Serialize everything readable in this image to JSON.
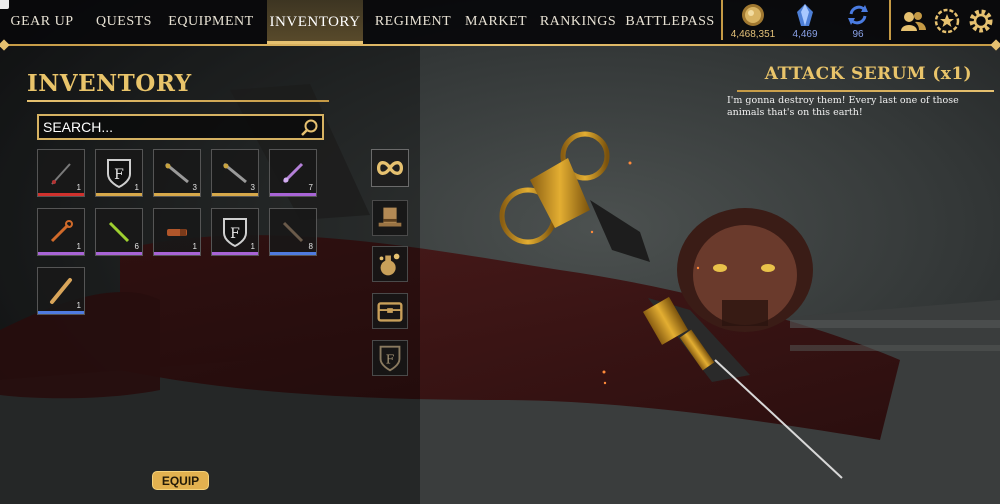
{
  "nav": {
    "tabs": [
      {
        "label": "GEAR UP"
      },
      {
        "label": "QUESTS"
      },
      {
        "label": "EQUIPMENT"
      },
      {
        "label": "INVENTORY",
        "active": true
      },
      {
        "label": "REGIMENT"
      },
      {
        "label": "MARKET"
      },
      {
        "label": "RANKINGS"
      },
      {
        "label": "BATTLEPASS"
      }
    ],
    "currencies": [
      {
        "icon": "gold-coin-icon",
        "value": "4,468,351",
        "color": "#e4c27a"
      },
      {
        "icon": "blue-crystal-icon",
        "value": "4,469",
        "color": "#8aa2e8"
      },
      {
        "icon": "refresh-token-icon",
        "value": "96",
        "color": "#8aa2e8"
      }
    ],
    "buttons": [
      "friends-icon",
      "achievements-icon",
      "settings-icon"
    ]
  },
  "inventory": {
    "title": "INVENTORY",
    "search_placeholder": "SEARCH...",
    "items": [
      {
        "icon": "red-blade-icon",
        "qty": "1",
        "rarity": "#d0312d"
      },
      {
        "icon": "family-crest-icon",
        "qty": "1",
        "rarity": "#d6a84a"
      },
      {
        "icon": "syringe-icon",
        "qty": "3",
        "rarity": "#d6a84a"
      },
      {
        "icon": "syringe-icon",
        "qty": "3",
        "rarity": "#d6a84a"
      },
      {
        "icon": "purple-syringe-icon",
        "qty": "7",
        "rarity": "#a864d6"
      },
      {
        "icon": "orange-key-icon",
        "qty": "1",
        "rarity": "#a864d6"
      },
      {
        "icon": "green-blade-icon",
        "qty": "6",
        "rarity": "#a864d6"
      },
      {
        "icon": "canister-icon",
        "qty": "1",
        "rarity": "#a864d6"
      },
      {
        "icon": "family-crest-icon",
        "qty": "1",
        "rarity": "#a864d6"
      },
      {
        "icon": "dark-blade-icon",
        "qty": "8",
        "rarity": "#4f7be0"
      },
      {
        "icon": "wooden-stick-icon",
        "qty": "1",
        "rarity": "#4f7be0"
      }
    ],
    "categories": [
      "infinity-icon",
      "top-hat-icon",
      "potion-icon",
      "chest-icon",
      "family-crest-icon"
    ],
    "equip_label": "EQUIP"
  },
  "detail": {
    "title": "ATTACK SERUM (x1)",
    "description": "I'm gonna destroy them! Every last one of those animals that's on this earth!"
  },
  "colors": {
    "accent_gold": "#e9c46a",
    "topbar": "#08090b",
    "rarity_red": "#d0312d",
    "rarity_gold": "#d6a84a",
    "rarity_purple": "#a864d6",
    "rarity_blue": "#4f7be0"
  }
}
